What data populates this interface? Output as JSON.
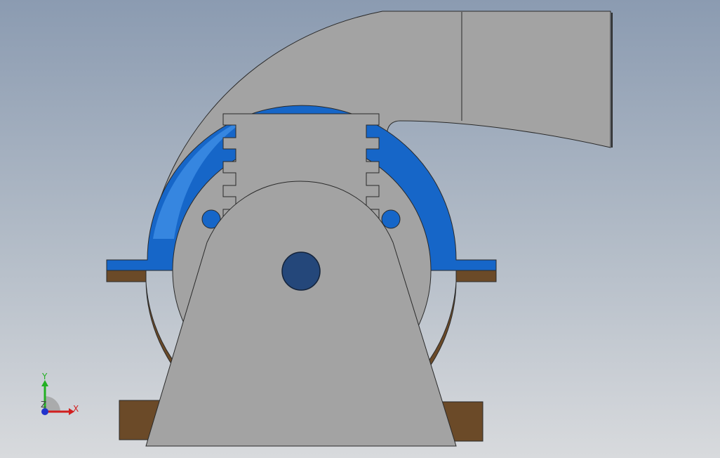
{
  "viewport": {
    "background_top": "#8b9bb1",
    "background_bottom": "#d8dadd"
  },
  "model": {
    "colors": {
      "housing_gray": "#a3a3a3",
      "cover_blue": "#1666c8",
      "cover_blue_light": "#3f8fe6",
      "base_brown": "#6b4a28",
      "shaft_blue": "#24477a",
      "outline": "#2a2a2a"
    }
  },
  "triad": {
    "x_label": "X",
    "y_label": "Y",
    "z_label": "Z",
    "x_color": "#d11f1f",
    "y_color": "#22b022",
    "z_color": "#2233cc"
  }
}
